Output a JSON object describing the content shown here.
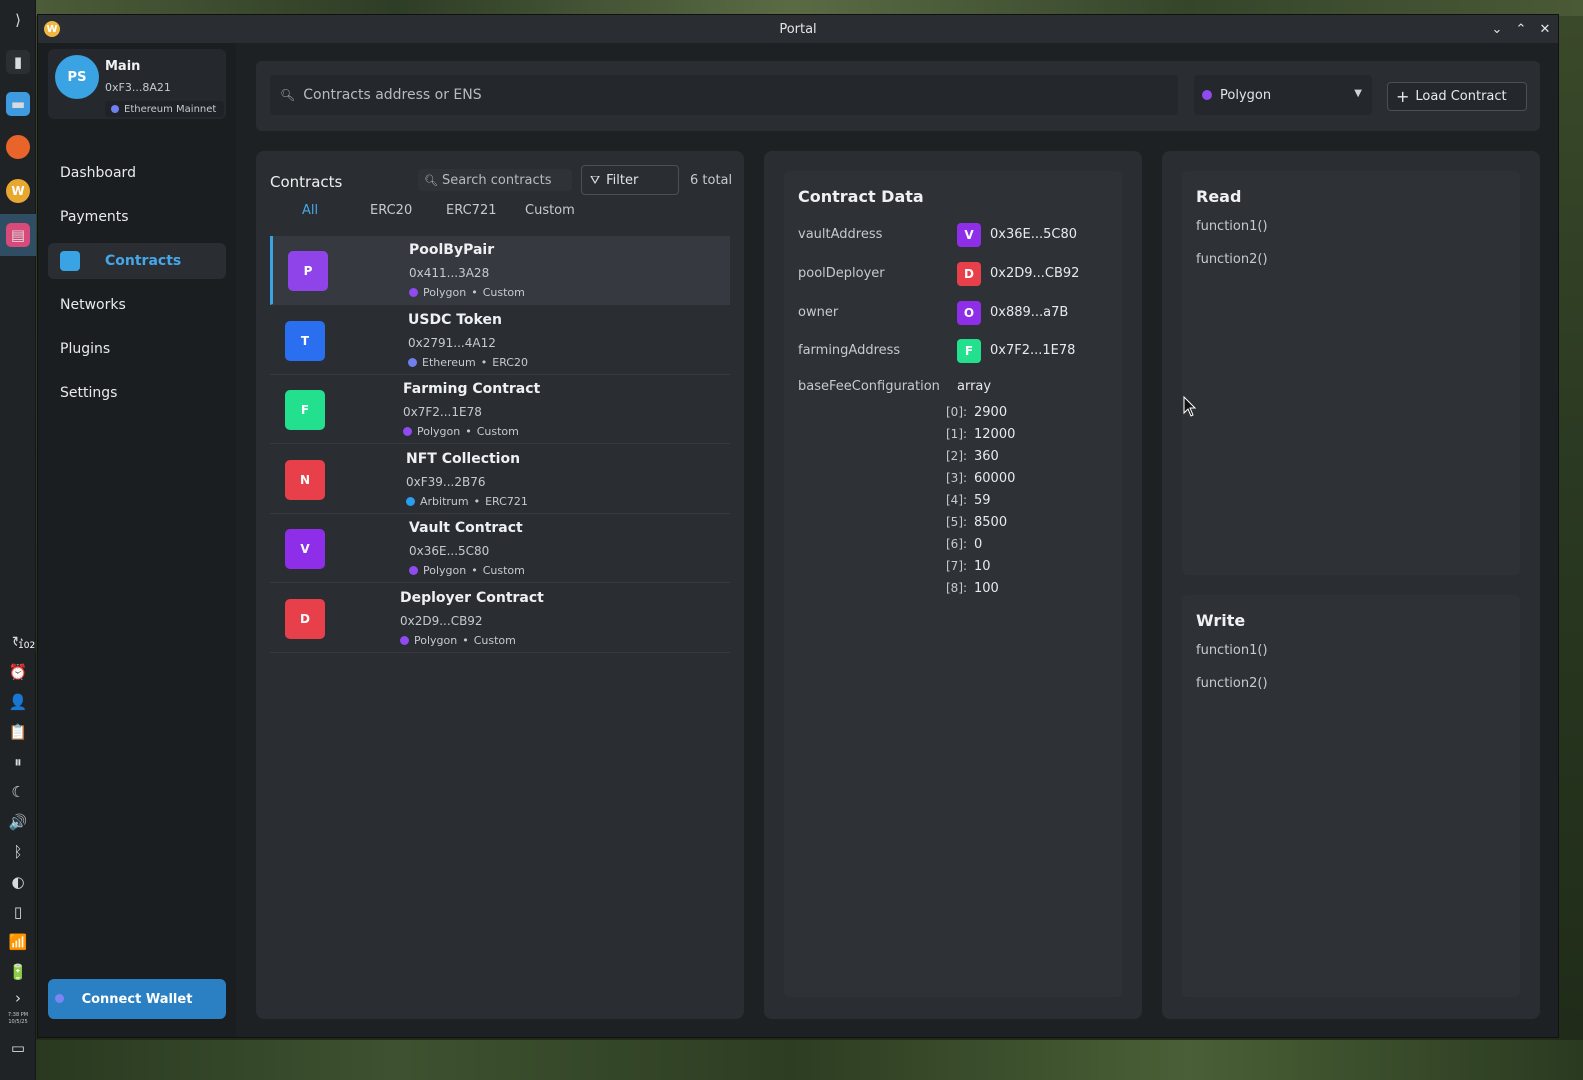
{
  "window": {
    "title": "Portal"
  },
  "taskbar": {
    "notification_count": "102",
    "clock_time": "7:38 PM",
    "clock_date": "10/5/25"
  },
  "account": {
    "initials": "PS",
    "name": "Main",
    "address": "0xF3...8A21",
    "network": "Ethereum Mainnet",
    "network_color": "#6f7ff0"
  },
  "nav": [
    {
      "label": "Dashboard"
    },
    {
      "label": "Payments"
    },
    {
      "label": "Contracts"
    },
    {
      "label": "Networks"
    },
    {
      "label": "Plugins"
    },
    {
      "label": "Settings"
    }
  ],
  "connect_button": "Connect Wallet",
  "search": {
    "placeholder": "Contracts address or ENS"
  },
  "network_select": {
    "value": "Polygon",
    "color": "#8f4af0"
  },
  "load_contract": "Load Contract",
  "contracts": {
    "title": "Contracts",
    "search_placeholder": "Search contracts",
    "filter_label": "Filter",
    "total": "6 total",
    "tabs": [
      "All",
      "ERC20",
      "ERC721",
      "Custom"
    ],
    "items": [
      {
        "letter": "P",
        "color": "#8e44e8",
        "name": "PoolByPair",
        "address": "0x411...3A28",
        "network": "Polygon",
        "network_color": "#8f4af0",
        "type": "Custom"
      },
      {
        "letter": "T",
        "color": "#2a6ff0",
        "name": "USDC Token",
        "address": "0x2791...4A12",
        "network": "Ethereum",
        "network_color": "#6f7ff0",
        "type": "ERC20"
      },
      {
        "letter": "F",
        "color": "#22e08e",
        "name": "Farming Contract",
        "address": "0x7F2...1E78",
        "network": "Polygon",
        "network_color": "#8f4af0",
        "type": "Custom"
      },
      {
        "letter": "N",
        "color": "#e8404a",
        "name": "NFT Collection",
        "address": "0xF39...2B76",
        "network": "Arbitrum",
        "network_color": "#2a9df0",
        "type": "ERC721"
      },
      {
        "letter": "V",
        "color": "#8e2ee8",
        "name": "Vault Contract",
        "address": "0x36E...5C80",
        "network": "Polygon",
        "network_color": "#8f4af0",
        "type": "Custom"
      },
      {
        "letter": "D",
        "color": "#e8404a",
        "name": "Deployer Contract",
        "address": "0x2D9...CB92",
        "network": "Polygon",
        "network_color": "#8f4af0",
        "type": "Custom"
      }
    ]
  },
  "contract_data": {
    "title": "Contract Data",
    "fields": [
      {
        "key": "vaultAddress",
        "letter": "V",
        "color": "#8e2ee8",
        "value": "0x36E...5C80"
      },
      {
        "key": "poolDeployer",
        "letter": "D",
        "color": "#e8404a",
        "value": "0x2D9...CB92"
      },
      {
        "key": "owner",
        "letter": "O",
        "color": "#8e2ee8",
        "value": "0x889...a7B"
      },
      {
        "key": "farmingAddress",
        "letter": "F",
        "color": "#22e08e",
        "value": "0x7F2...1E78"
      }
    ],
    "array_field": {
      "key": "baseFeeConfiguration",
      "type": "array",
      "items": [
        {
          "index": "[0]:",
          "value": "2900"
        },
        {
          "index": "[1]:",
          "value": "12000"
        },
        {
          "index": "[2]:",
          "value": "360"
        },
        {
          "index": "[3]:",
          "value": "60000"
        },
        {
          "index": "[4]:",
          "value": "59"
        },
        {
          "index": "[5]:",
          "value": "8500"
        },
        {
          "index": "[6]:",
          "value": "0"
        },
        {
          "index": "[7]:",
          "value": "10"
        },
        {
          "index": "[8]:",
          "value": "100"
        }
      ]
    }
  },
  "read": {
    "title": "Read",
    "functions": [
      "function1()",
      "function2()"
    ]
  },
  "write": {
    "title": "Write",
    "functions": [
      "function1()",
      "function2()"
    ]
  }
}
